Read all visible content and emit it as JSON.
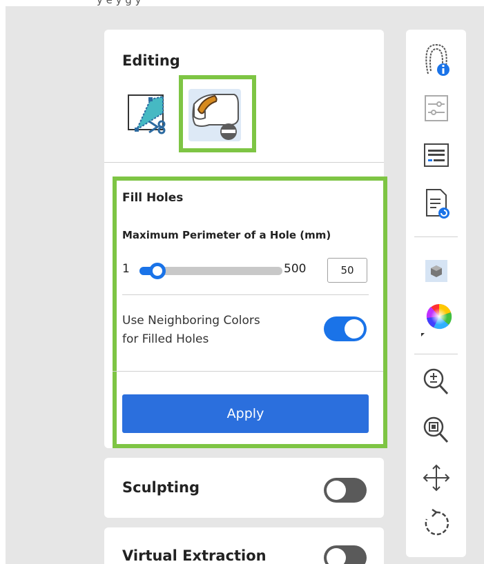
{
  "top_strip_text": "y e y g y",
  "editing": {
    "title": "Editing",
    "tools": [
      {
        "icon": "trim-scissors-icon"
      },
      {
        "icon": "fill-holes-icon",
        "selected": true
      }
    ]
  },
  "fill_holes": {
    "title": "Fill Holes",
    "perimeter_label": "Maximum Perimeter of a Hole (mm)",
    "slider": {
      "min": "1",
      "max": "500",
      "value": "50",
      "fraction": 0.07
    },
    "neighbor_label_line1": "Use Neighboring Colors",
    "neighbor_label_line2": "for Filled Holes",
    "neighbor_toggle_on": true,
    "apply_label": "Apply"
  },
  "sections": [
    {
      "title": "Sculpting",
      "toggle_on": false
    },
    {
      "title": "Virtual Extraction",
      "toggle_on": false
    }
  ],
  "right_toolbar": {
    "icons": [
      "tooth-info-icon",
      "sliders-icon",
      "keyboard-icon",
      "report-icon",
      "cube-view-icon",
      "color-wheel-icon",
      "zoom-fit-icon",
      "zoom-reset-icon",
      "move-icon",
      "rotate-icon"
    ]
  },
  "colors": {
    "highlight": "#7ec544",
    "accent": "#1a73e8",
    "apply_button": "#2b6fdd",
    "workspace": "#e6e6e6"
  }
}
